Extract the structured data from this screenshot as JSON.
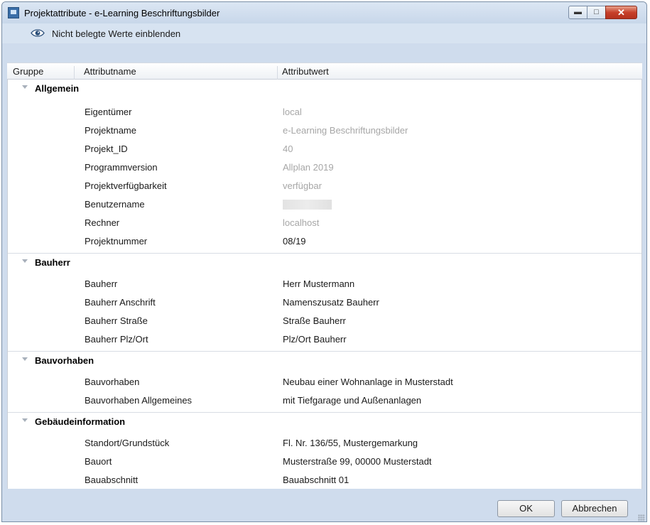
{
  "window": {
    "title": "Projektattribute - e-Learning Beschriftungsbilder"
  },
  "toolbar": {
    "show_empty_label": "Nicht belegte Werte einblenden",
    "icon": "eye-icon"
  },
  "columns": {
    "group": "Gruppe",
    "attribute_name": "Attributname",
    "attribute_value": "Attributwert"
  },
  "groups": [
    {
      "label": "Allgemein",
      "attributes": [
        {
          "name": "Eigentümer",
          "value": "local",
          "dim": true
        },
        {
          "name": "Projektname",
          "value": "e-Learning Beschriftungsbilder",
          "dim": true
        },
        {
          "name": "Projekt_ID",
          "value": "40",
          "dim": true
        },
        {
          "name": "Programmversion",
          "value": "Allplan 2019",
          "dim": true
        },
        {
          "name": "Projektverfügbarkeit",
          "value": "verfügbar",
          "dim": true
        },
        {
          "name": "Benutzername",
          "value": "",
          "dim": true,
          "redacted": true
        },
        {
          "name": "Rechner",
          "value": "localhost",
          "dim": true
        },
        {
          "name": "Projektnummer",
          "value": "08/19",
          "dim": false
        }
      ]
    },
    {
      "label": "Bauherr",
      "attributes": [
        {
          "name": "Bauherr",
          "value": "Herr Mustermann",
          "dim": false
        },
        {
          "name": "Bauherr Anschrift",
          "value": "Namenszusatz Bauherr",
          "dim": false
        },
        {
          "name": "Bauherr Straße",
          "value": "Straße Bauherr",
          "dim": false
        },
        {
          "name": "Bauherr Plz/Ort",
          "value": "Plz/Ort Bauherr",
          "dim": false
        }
      ]
    },
    {
      "label": "Bauvorhaben",
      "attributes": [
        {
          "name": "Bauvorhaben",
          "value": "Neubau einer Wohnanlage in Musterstadt",
          "dim": false
        },
        {
          "name": "Bauvorhaben Allgemeines",
          "value": "mit Tiefgarage und Außenanlagen",
          "dim": false
        }
      ]
    },
    {
      "label": "Gebäudeinformation",
      "attributes": [
        {
          "name": "Standort/Grundstück",
          "value": "Fl. Nr. 136/55, Mustergemarkung",
          "dim": false
        },
        {
          "name": "Bauort",
          "value": "Musterstraße 99, 00000 Musterstadt",
          "dim": false
        },
        {
          "name": "Bauabschnitt",
          "value": "Bauabschnitt 01",
          "dim": false
        }
      ]
    }
  ],
  "buttons": {
    "ok": "OK",
    "cancel": "Abbrechen"
  }
}
